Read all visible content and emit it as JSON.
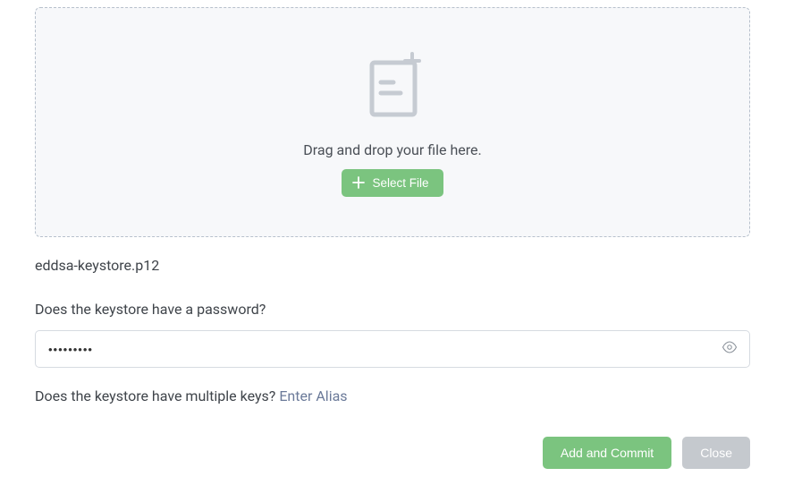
{
  "dropzone": {
    "text": "Drag and drop your file here.",
    "button": "Select File"
  },
  "file": {
    "name": "eddsa-keystore.p12"
  },
  "password": {
    "label": "Does the keystore have a password?",
    "value": "•••••••••"
  },
  "alias": {
    "question": "Does the keystore have multiple keys? ",
    "link": "Enter Alias"
  },
  "footer": {
    "commit": "Add and Commit",
    "close": "Close"
  }
}
